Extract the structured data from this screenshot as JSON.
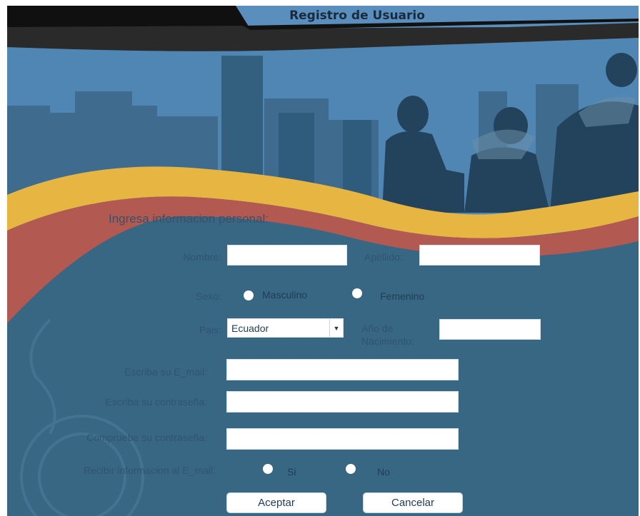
{
  "window": {
    "title": "Registro de Usuario"
  },
  "section_title": "Ingresa informacion personal:",
  "form": {
    "nombre": {
      "label": "Nombre:",
      "value": ""
    },
    "apellido": {
      "label": "Apellido:",
      "value": ""
    },
    "sexo": {
      "label": "Sexo:",
      "options": [
        "Masculino",
        "Femenino"
      ]
    },
    "pais": {
      "label": "Pais:",
      "selected": "Ecuador"
    },
    "anio_nacimiento": {
      "label_line1": "Año de",
      "label_line2": "Nacimiento:",
      "value": ""
    },
    "email": {
      "label": "Escriba su E_mail:",
      "value": ""
    },
    "password": {
      "label": "Escriba su contraseña:",
      "value": ""
    },
    "password_confirm": {
      "label": "Compruebe su contraseña:",
      "value": ""
    },
    "recibir_info": {
      "label": "Recibir informacion al E_mail:",
      "options": [
        "Si",
        "No"
      ]
    }
  },
  "buttons": {
    "accept": "Aceptar",
    "cancel": "Cancelar"
  },
  "colors": {
    "background": "#386784",
    "yellow_band": "#e7b642",
    "red_band": "#b25a52",
    "sky": "#4f86b4",
    "label_text": "#2f5470"
  }
}
